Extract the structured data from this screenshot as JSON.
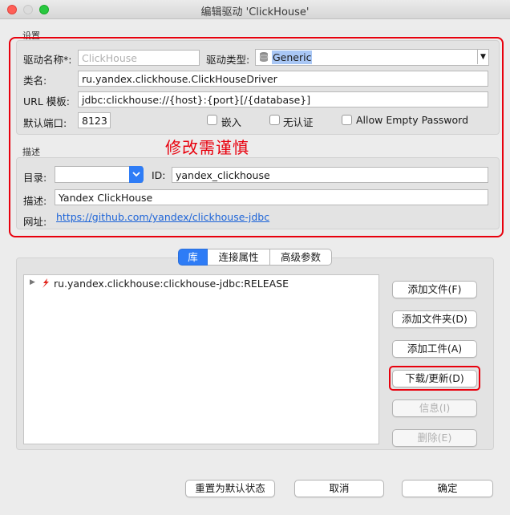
{
  "window": {
    "title": "编辑驱动 'ClickHouse'"
  },
  "settings": {
    "section_label": "设置",
    "driver_name_label": "驱动名称*:",
    "driver_name_placeholder": "ClickHouse",
    "driver_type_label": "驱动类型:",
    "driver_type_value": "Generic",
    "class_name_label": "类名:",
    "class_name_value": "ru.yandex.clickhouse.ClickHouseDriver",
    "url_template_label": "URL 模板:",
    "url_template_value": "jdbc:clickhouse://{host}:{port}[/{database}]",
    "default_port_label": "默认端口:",
    "default_port_value": "8123",
    "embedded_label": "嵌入",
    "no_auth_label": "无认证",
    "allow_empty_password_label": "Allow Empty Password"
  },
  "description": {
    "section_label": "描述",
    "warning_text": "修改需谨慎",
    "category_label": "目录:",
    "category_value": "",
    "id_label": "ID:",
    "id_value": "yandex_clickhouse",
    "description_label": "描述:",
    "description_value": "Yandex ClickHouse",
    "website_label": "网址:",
    "website_url": "https://github.com/yandex/clickhouse-jdbc"
  },
  "tabs": [
    {
      "label": "库",
      "active": true
    },
    {
      "label": "连接属性",
      "active": false
    },
    {
      "label": "高级参数",
      "active": false
    }
  ],
  "libraries": {
    "items": [
      {
        "label": "ru.yandex.clickhouse:clickhouse-jdbc:RELEASE"
      }
    ]
  },
  "library_buttons": {
    "add_file": "添加文件(F)",
    "add_folder": "添加文件夹(D)",
    "add_artifact": "添加工件(A)",
    "download_update": "下载/更新(D)",
    "info": "信息(I)",
    "delete": "删除(E)"
  },
  "footer": {
    "reset_label": "重置为默认状态",
    "cancel_label": "取消",
    "ok_label": "确定"
  },
  "colors": {
    "highlight_red": "#e8000d",
    "accent_blue": "#2e7cf6",
    "link_blue": "#1d64d8"
  }
}
